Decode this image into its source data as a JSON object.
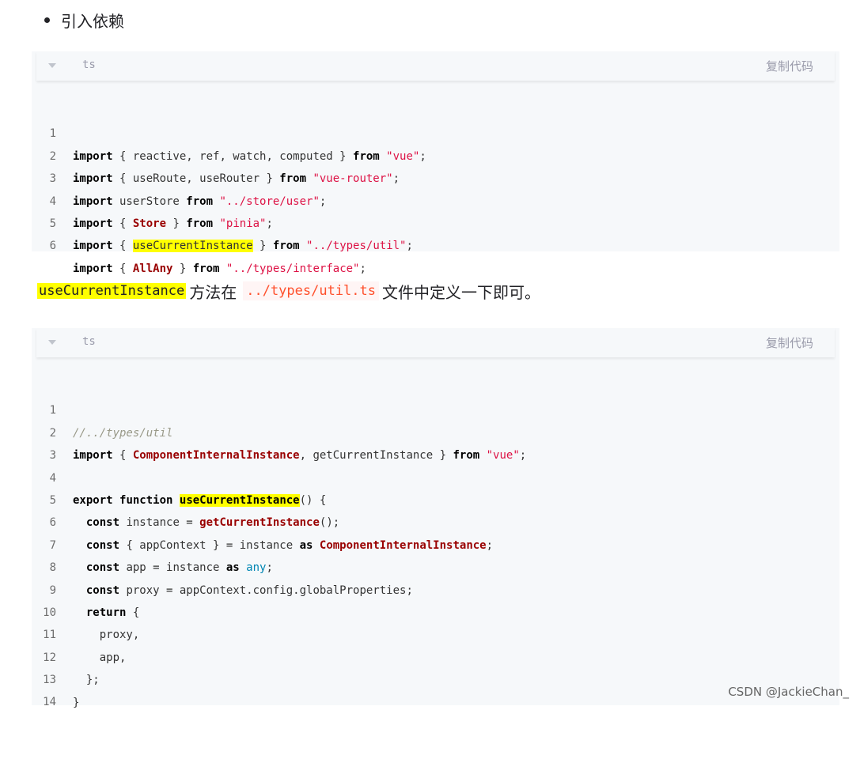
{
  "bullet": {
    "text": "引入依赖"
  },
  "block1": {
    "lang": "ts",
    "copy_label": "复制代码",
    "lines": [
      {
        "n": "1"
      },
      {
        "n": "2"
      },
      {
        "n": "3"
      },
      {
        "n": "4"
      },
      {
        "n": "5"
      },
      {
        "n": "6"
      }
    ]
  },
  "paragraph": {
    "hl_code": "useCurrentInstance",
    "text1": "方法在",
    "inline_code": "../types/util.ts",
    "text2": "文件中定义一下即可。"
  },
  "block2": {
    "lang": "ts",
    "copy_label": "复制代码",
    "lines": [
      {
        "n": "1"
      },
      {
        "n": "2"
      },
      {
        "n": "3"
      },
      {
        "n": "4"
      },
      {
        "n": "5"
      },
      {
        "n": "6"
      },
      {
        "n": "7"
      },
      {
        "n": "8"
      },
      {
        "n": "9"
      },
      {
        "n": "10"
      },
      {
        "n": "11"
      },
      {
        "n": "12"
      },
      {
        "n": "13"
      },
      {
        "n": "14"
      }
    ]
  },
  "code1": {
    "l1": {
      "a": "import",
      "b": " { reactive, ref, watch, computed } ",
      "c": "from",
      "d": " ",
      "e": "\"vue\"",
      "f": ";"
    },
    "l2": {
      "a": "import",
      "b": " { useRoute, useRouter } ",
      "c": "from",
      "d": " ",
      "e": "\"vue-router\"",
      "f": ";"
    },
    "l3": {
      "a": "import",
      "b": " userStore ",
      "c": "from",
      "d": " ",
      "e": "\"../store/user\"",
      "f": ";"
    },
    "l4": {
      "a": "import",
      "b": " { ",
      "t": "Store",
      "b2": " } ",
      "c": "from",
      "d": " ",
      "e": "\"pinia\"",
      "f": ";"
    },
    "l5": {
      "a": "import",
      "b": " { ",
      "h": "useCurrentInstance",
      "b2": " } ",
      "c": "from",
      "d": " ",
      "e": "\"../types/util\"",
      "f": ";"
    },
    "l6": {
      "a": "import",
      "b": " { ",
      "t": "AllAny",
      "b2": " } ",
      "c": "from",
      "d": " ",
      "e": "\"../types/interface\"",
      "f": ";"
    }
  },
  "code2": {
    "l1": "//../types/util",
    "l2": {
      "a": "import",
      "b": " { ",
      "t": "ComponentInternalInstance",
      "b2": ", getCurrentInstance } ",
      "c": "from",
      "d": " ",
      "e": "\"vue\"",
      "f": ";"
    },
    "l4": {
      "a": "export",
      "b": " ",
      "c": "function",
      "d": " ",
      "h": "useCurrentInstance",
      "e": "() {"
    },
    "l5": {
      "i": "  ",
      "a": "const",
      "b": " instance = ",
      "t": "getCurrentInstance",
      "e": "();"
    },
    "l6": {
      "i": "  ",
      "a": "const",
      "b": " { appContext } = instance ",
      "c": "as",
      "d": " ",
      "t": "ComponentInternalInstance",
      "e": ";"
    },
    "l7": {
      "i": "  ",
      "a": "const",
      "b": " app = instance ",
      "c": "as",
      "d": " ",
      "y": "any",
      "e": ";"
    },
    "l8": {
      "i": "  ",
      "a": "const",
      "b": " proxy = appContext.config.globalProperties;"
    },
    "l9": {
      "i": "  ",
      "a": "return",
      "b": " {"
    },
    "l10": "    proxy,",
    "l11": "    app,",
    "l12": "  };",
    "l13": "}"
  },
  "watermark": "CSDN @JackieChan_"
}
